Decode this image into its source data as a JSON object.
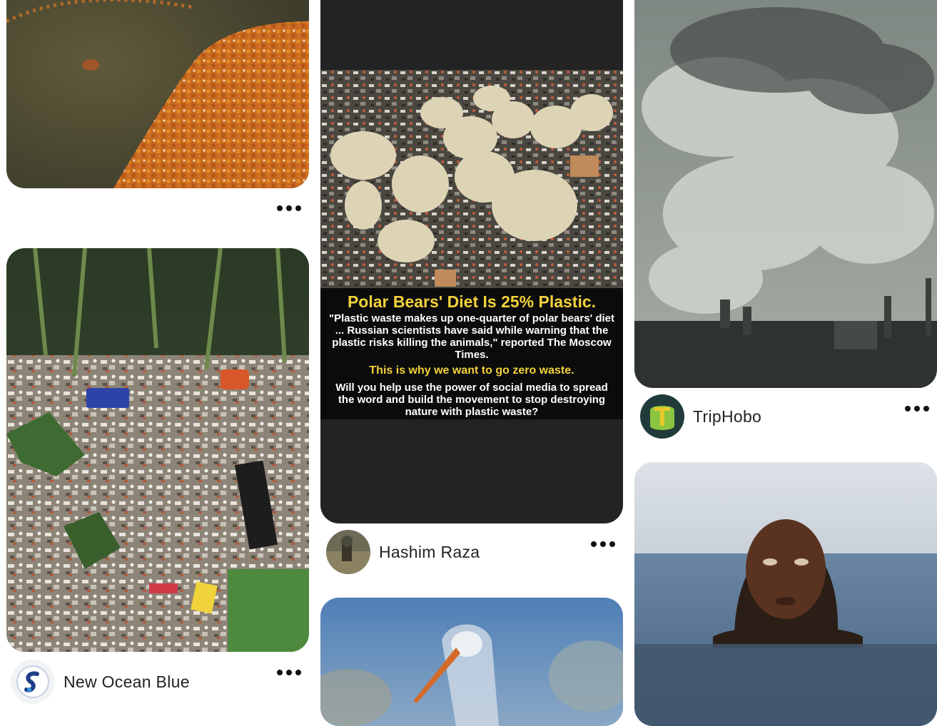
{
  "feed": {
    "pins": [
      {
        "id": "river-flowers",
        "author": ""
      },
      {
        "id": "polar-bears",
        "author": "Hashim Raza",
        "infographic": {
          "headline": "Polar Bears' Diet Is 25% Plastic.",
          "quote": "\"Plastic waste makes up one-quarter of polar bears' diet ... Russian scientists have said while warning that the plastic risks killing the animals,\" reported The Moscow Times.",
          "tagline": "This is why we want to go zero waste.",
          "cta": "Will you help use the power of social media to spread the word and build the movement to stop destroying nature with plastic waste?"
        }
      },
      {
        "id": "factory-smoke",
        "author": "TripHobo"
      },
      {
        "id": "forest-trash",
        "author": "New Ocean Blue"
      },
      {
        "id": "stork-plastic",
        "author": ""
      },
      {
        "id": "oil-girl",
        "author": ""
      }
    ]
  },
  "icons": {
    "more": "more-horizontal-icon"
  },
  "colors": {
    "headline_yellow": "#f3d23c",
    "text_dark": "#222222"
  }
}
